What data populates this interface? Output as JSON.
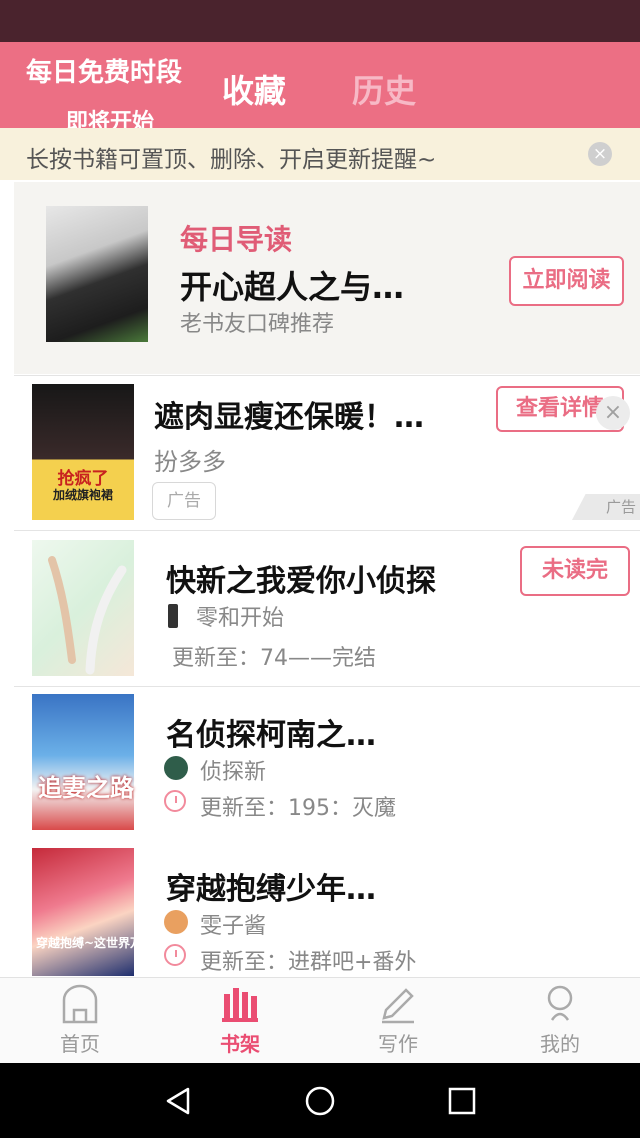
{
  "header": {
    "promo_line1": "每日免费时段",
    "promo_line2": "即将开始",
    "tab_favorites": "收藏",
    "tab_history": "历史"
  },
  "notice": {
    "text": "长按书籍可置顶、删除、开启更新提醒~",
    "close_icon": "×"
  },
  "daily": {
    "label": "每日导读",
    "title": "开心超人之与…",
    "subtitle": "老书友口碑推荐",
    "button": "立即阅读"
  },
  "ad": {
    "title": "遮肉显瘦还保暖！…",
    "author": "扮多多",
    "tag": "广告",
    "button": "查看详情",
    "badge": "广告",
    "cover_text": "抢疯了",
    "cover_text2": "加绒旗袍裙"
  },
  "books": [
    {
      "title": "快新之我爱你小侦探",
      "author": "零和开始",
      "update": "更新至：74——完结",
      "button": "未读完"
    },
    {
      "title": "名侦探柯南之…",
      "author": "侦探新",
      "update": "更新至：195：灭魔",
      "cover_text": "追妻之路"
    },
    {
      "title": "穿越抱缚少年…",
      "author": "雯子酱",
      "update": "更新至：进群吧+番外",
      "cover_text": "穿越抱缚~这世界万"
    }
  ],
  "tabbar": {
    "home": "首页",
    "shelf": "书架",
    "write": "写作",
    "me": "我的"
  },
  "colors": {
    "accent": "#ea6d84",
    "header_bg": "#ec6f84",
    "status_bg": "#4a232d"
  }
}
